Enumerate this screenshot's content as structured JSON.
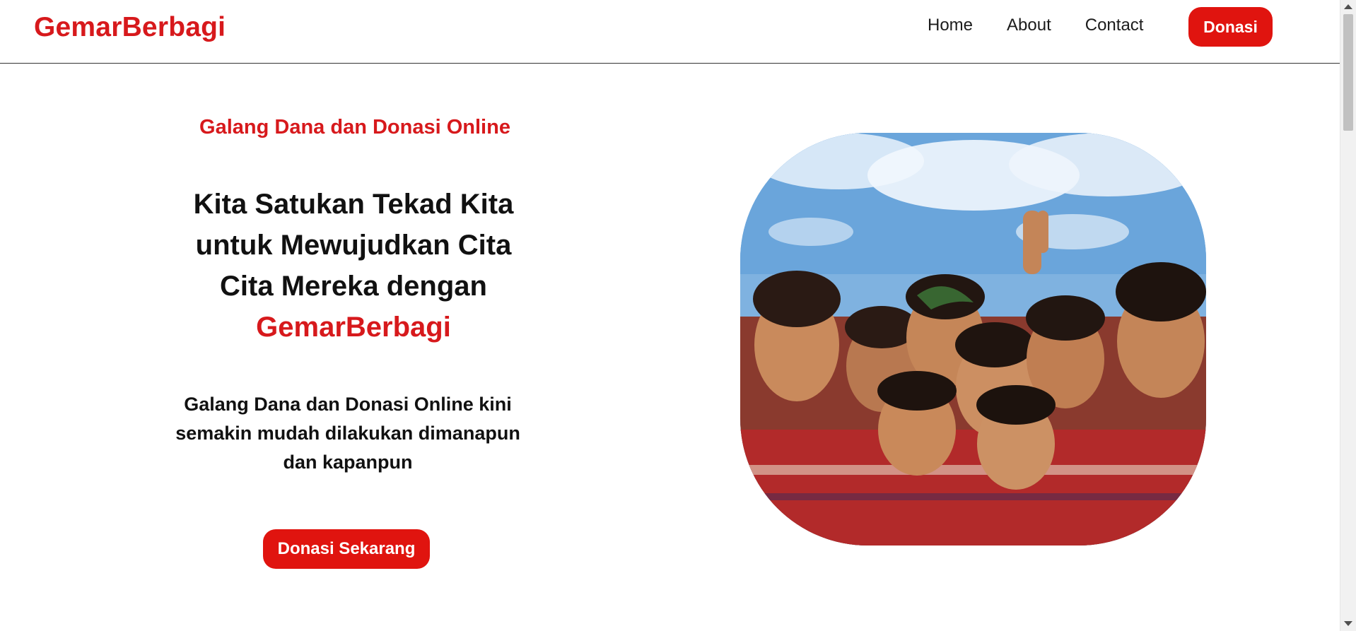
{
  "header": {
    "brand": "GemarBerbagi",
    "nav": [
      {
        "label": "Home"
      },
      {
        "label": "About"
      },
      {
        "label": "Contact"
      }
    ],
    "cta_label": "Donasi"
  },
  "hero": {
    "tagline": "Galang Dana dan Donasi Online",
    "headline_lines": [
      "Kita Satukan Tekad Kita",
      "untuk Mewujudkan Cita",
      "Cita Mereka dengan"
    ],
    "headline_brand": "GemarBerbagi",
    "subtext": "Galang Dana dan Donasi Online kini semakin mudah dilakukan dimanapun dan kapanpun",
    "button_label": "Donasi Sekarang"
  },
  "colors": {
    "accent": "#e0140f",
    "brand_text": "#d7191c",
    "text": "#111111"
  },
  "icons": {
    "scroll_up": "scroll-up-arrow-icon",
    "scroll_down": "scroll-down-arrow-icon"
  }
}
